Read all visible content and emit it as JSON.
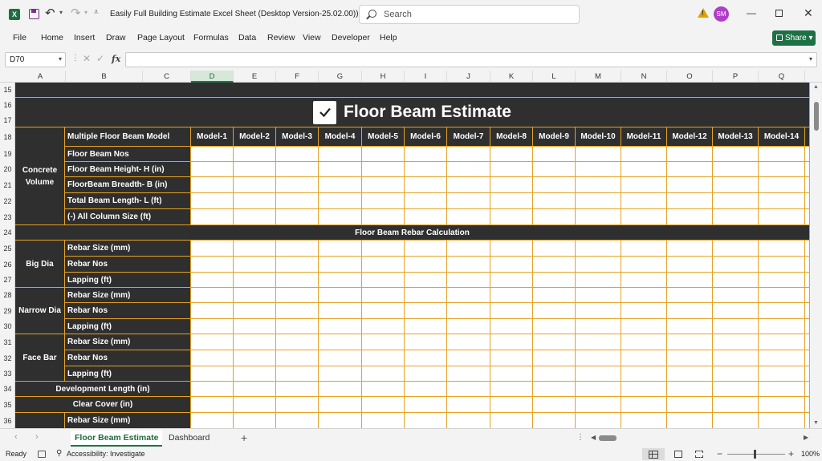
{
  "title_bar": {
    "doc_title": "Easily Full Building Estimate Excel Sheet (Desktop Version-25.02.00))  -  E...",
    "search_placeholder": "Search",
    "avatar_initials": "SM",
    "excel_logo": "X",
    "icons": [
      "excel-logo-icon",
      "save-icon",
      "undo-icon",
      "redo-icon",
      "search-icon",
      "warning-icon",
      "minimize-icon",
      "maximize-icon",
      "close-icon"
    ]
  },
  "menu": {
    "items": [
      "File",
      "Home",
      "Insert",
      "Draw",
      "Page Layout",
      "Formulas",
      "Data",
      "Review",
      "View",
      "Developer",
      "Help"
    ],
    "share_label": "Share"
  },
  "formula_bar": {
    "name_box": "D70",
    "fx": "fx",
    "formula": ""
  },
  "columns": [
    "A",
    "B",
    "C",
    "D",
    "E",
    "F",
    "G",
    "H",
    "I",
    "J",
    "K",
    "L",
    "M",
    "N",
    "O",
    "P",
    "Q"
  ],
  "selected_column": "D",
  "rows": [
    "15",
    "16",
    "17",
    "18",
    "19",
    "20",
    "21",
    "22",
    "23",
    "24",
    "25",
    "26",
    "27",
    "28",
    "29",
    "30",
    "31",
    "32",
    "33",
    "34",
    "35",
    "36"
  ],
  "sheet": {
    "title": "Floor Beam Estimate",
    "header_label": "Multiple Floor Beam Model",
    "models": [
      "Model-1",
      "Model-2",
      "Model-3",
      "Model-4",
      "Model-5",
      "Model-6",
      "Model-7",
      "Model-8",
      "Model-9",
      "Model-10",
      "Model-11",
      "Model-12",
      "Model-13",
      "Model-14"
    ],
    "concrete_group": "Concrete Volume",
    "concrete_items": [
      "Floor Beam Nos",
      "Floor Beam Height- H (in)",
      "FloorBeam Breadth- B (in)",
      "Total Beam Length- L (ft)",
      "(-) All Column Size (ft)"
    ],
    "rebar_section": "Floor Beam Rebar Calculation",
    "big_dia": "Big Dia",
    "narrow_dia": "Narrow Dia",
    "face_bar": "Face Bar",
    "rebar_items": [
      "Rebar Size (mm)",
      "Rebar Nos",
      "Lapping (ft)"
    ],
    "development_length": "Development Length (in)",
    "clear_cover": "Clear Cover (in)",
    "last_item": "Rebar Size (mm)"
  },
  "tabs": {
    "active": "Floor Beam Estimate",
    "inactive": "Dashboard"
  },
  "status": {
    "ready": "Ready",
    "accessibility": "Accessibility: Investigate",
    "zoom": "100%"
  },
  "colors": {
    "dark_fill": "#2f2f2f",
    "border_gold": "#e5a224",
    "excel_green": "#217346"
  }
}
